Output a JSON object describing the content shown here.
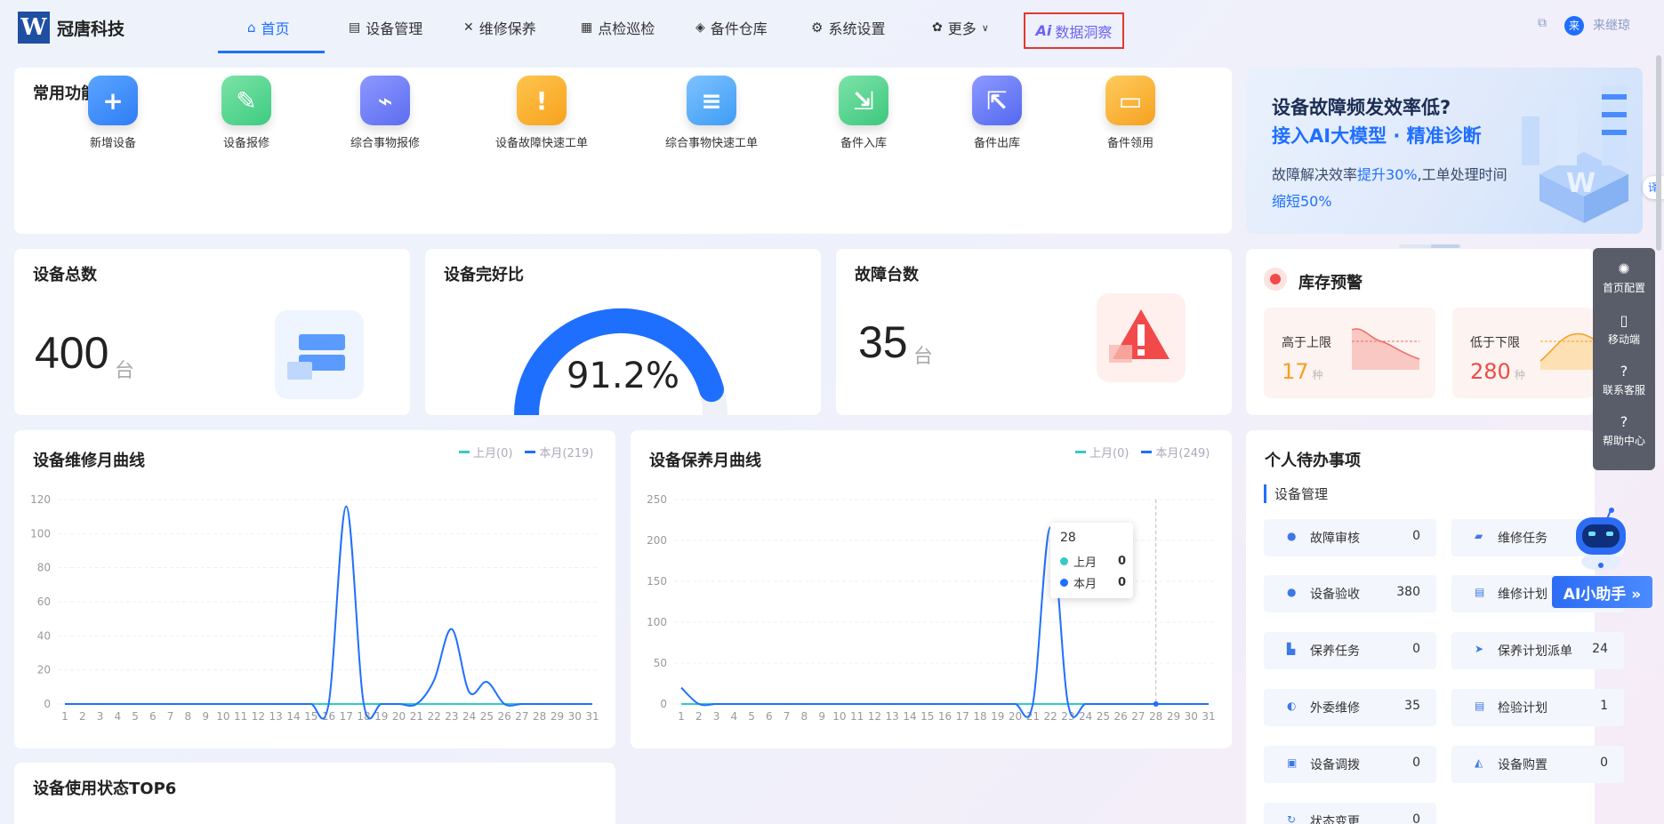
{
  "header": {
    "logo_letter": "W",
    "brand": "冠唐科技",
    "nav": [
      {
        "label": "首页",
        "icon": "home-icon"
      },
      {
        "label": "设备管理",
        "icon": "device-icon"
      },
      {
        "label": "维修保养",
        "icon": "tools-icon"
      },
      {
        "label": "点检巡检",
        "icon": "inspect-icon"
      },
      {
        "label": "备件仓库",
        "icon": "box-icon"
      },
      {
        "label": "系统设置",
        "icon": "gear-icon"
      },
      {
        "label": "更多",
        "icon": "grid-icon"
      }
    ],
    "ai_label": "数据洞察",
    "ai_prefix": "Ai",
    "avatar_char": "来",
    "user_name": "来继琼"
  },
  "quick": {
    "title": "常用功能",
    "items": [
      {
        "label": "新增设备",
        "color": "#2f7cf6"
      },
      {
        "label": "设备报修",
        "color": "#3dcb82"
      },
      {
        "label": "综合事物报修",
        "color": "#5b6df0"
      },
      {
        "label": "设备故障快速工单",
        "color": "#f7a21d"
      },
      {
        "label": "综合事物快速工单",
        "color": "#3d9cf5"
      },
      {
        "label": "备件入库",
        "color": "#3cc77e"
      },
      {
        "label": "备件出库",
        "color": "#5268f0"
      },
      {
        "label": "备件领用",
        "color": "#f6a01f"
      }
    ]
  },
  "banner": {
    "line1": "设备故障频发效率低?",
    "line2": "接入AI大模型 · 精准诊断",
    "line3_a": "故障解决效率",
    "line3_b": "提升30%",
    "line3_c": ",工单处理时间",
    "line4": "缩短50%"
  },
  "stats": {
    "total_title": "设备总数",
    "total_value": "400",
    "total_unit": "台",
    "rate_title": "设备完好比",
    "rate_value": "91.2%",
    "rate_fraction": 0.912,
    "fault_title": "故障台数",
    "fault_value": "35",
    "fault_unit": "台"
  },
  "inventory": {
    "title": "库存预警",
    "upper_label": "高于上限",
    "upper_value": "17",
    "upper_unit": "种",
    "lower_label": "低于下限",
    "lower_value": "280",
    "lower_unit": "种"
  },
  "chart_data": [
    {
      "type": "line",
      "title": "设备维修月曲线",
      "x": [
        1,
        2,
        3,
        4,
        5,
        6,
        7,
        8,
        9,
        10,
        11,
        12,
        13,
        14,
        15,
        16,
        17,
        18,
        19,
        20,
        21,
        22,
        23,
        24,
        25,
        26,
        27,
        28,
        29,
        30,
        31
      ],
      "series": [
        {
          "name": "上月(0)",
          "color": "#36c9c6",
          "values": [
            0,
            0,
            0,
            0,
            0,
            0,
            0,
            0,
            0,
            0,
            0,
            0,
            0,
            0,
            0,
            0,
            0,
            0,
            0,
            0,
            0,
            0,
            0,
            0,
            0,
            0,
            0,
            0,
            0,
            0,
            0
          ]
        },
        {
          "name": "本月(219)",
          "color": "#1f6fff",
          "values": [
            0,
            0,
            0,
            0,
            0,
            0,
            0,
            0,
            0,
            0,
            0,
            0,
            0,
            0,
            0,
            0,
            116,
            0,
            0,
            0,
            0,
            14,
            44,
            7,
            13,
            0,
            0,
            0,
            0,
            0,
            0
          ]
        }
      ],
      "ylim": [
        0,
        120
      ],
      "yticks": [
        0,
        20,
        40,
        60,
        80,
        100,
        120
      ]
    },
    {
      "type": "line",
      "title": "设备保养月曲线",
      "x": [
        1,
        2,
        3,
        4,
        5,
        6,
        7,
        8,
        9,
        10,
        11,
        12,
        13,
        14,
        15,
        16,
        17,
        18,
        19,
        20,
        21,
        22,
        23,
        24,
        25,
        26,
        27,
        28,
        29,
        30,
        31
      ],
      "series": [
        {
          "name": "上月(0)",
          "color": "#36c9c6",
          "values": [
            0,
            0,
            0,
            0,
            0,
            0,
            0,
            0,
            0,
            0,
            0,
            0,
            0,
            0,
            0,
            0,
            0,
            0,
            0,
            0,
            0,
            0,
            0,
            0,
            0,
            0,
            0,
            0,
            0,
            0,
            0
          ]
        },
        {
          "name": "本月(249)",
          "color": "#1f6fff",
          "values": [
            20,
            0,
            0,
            0,
            0,
            0,
            0,
            0,
            0,
            0,
            0,
            0,
            0,
            0,
            0,
            0,
            0,
            0,
            0,
            0,
            0,
            216,
            0,
            0,
            0,
            0,
            0,
            0,
            0,
            0,
            0
          ]
        }
      ],
      "ylim": [
        0,
        250
      ],
      "yticks": [
        0,
        50,
        100,
        150,
        200,
        250
      ]
    }
  ],
  "tooltip": {
    "x": "28",
    "rows": [
      {
        "name": "上月",
        "value": "0",
        "color": "#36c9c6"
      },
      {
        "name": "本月",
        "value": "0",
        "color": "#1f6fff"
      }
    ]
  },
  "usage": {
    "title": "设备使用状态TOP6"
  },
  "todo": {
    "title": "个人待办事项",
    "sub": "设备管理",
    "items": [
      {
        "label": "故障审核",
        "value": "0"
      },
      {
        "label": "维修任务",
        "value": ""
      },
      {
        "label": "设备验收",
        "value": "380"
      },
      {
        "label": "维修计划",
        "value": ""
      },
      {
        "label": "保养任务",
        "value": "0"
      },
      {
        "label": "保养计划派单",
        "value": "24"
      },
      {
        "label": "外委维修",
        "value": "35"
      },
      {
        "label": "检验计划",
        "value": "1"
      },
      {
        "label": "设备调拨",
        "value": "0"
      },
      {
        "label": "设备购置",
        "value": "0"
      },
      {
        "label": "状态变更",
        "value": "0"
      }
    ]
  },
  "tools": {
    "items": [
      {
        "label": "首页配置",
        "icon": "bulb-icon"
      },
      {
        "label": "移动端",
        "icon": "mobile-icon"
      },
      {
        "label": "联系客服",
        "icon": "service-icon"
      },
      {
        "label": "帮助中心",
        "icon": "help-icon"
      }
    ]
  },
  "ai_helper": "AI小助手 »",
  "translate": "译"
}
